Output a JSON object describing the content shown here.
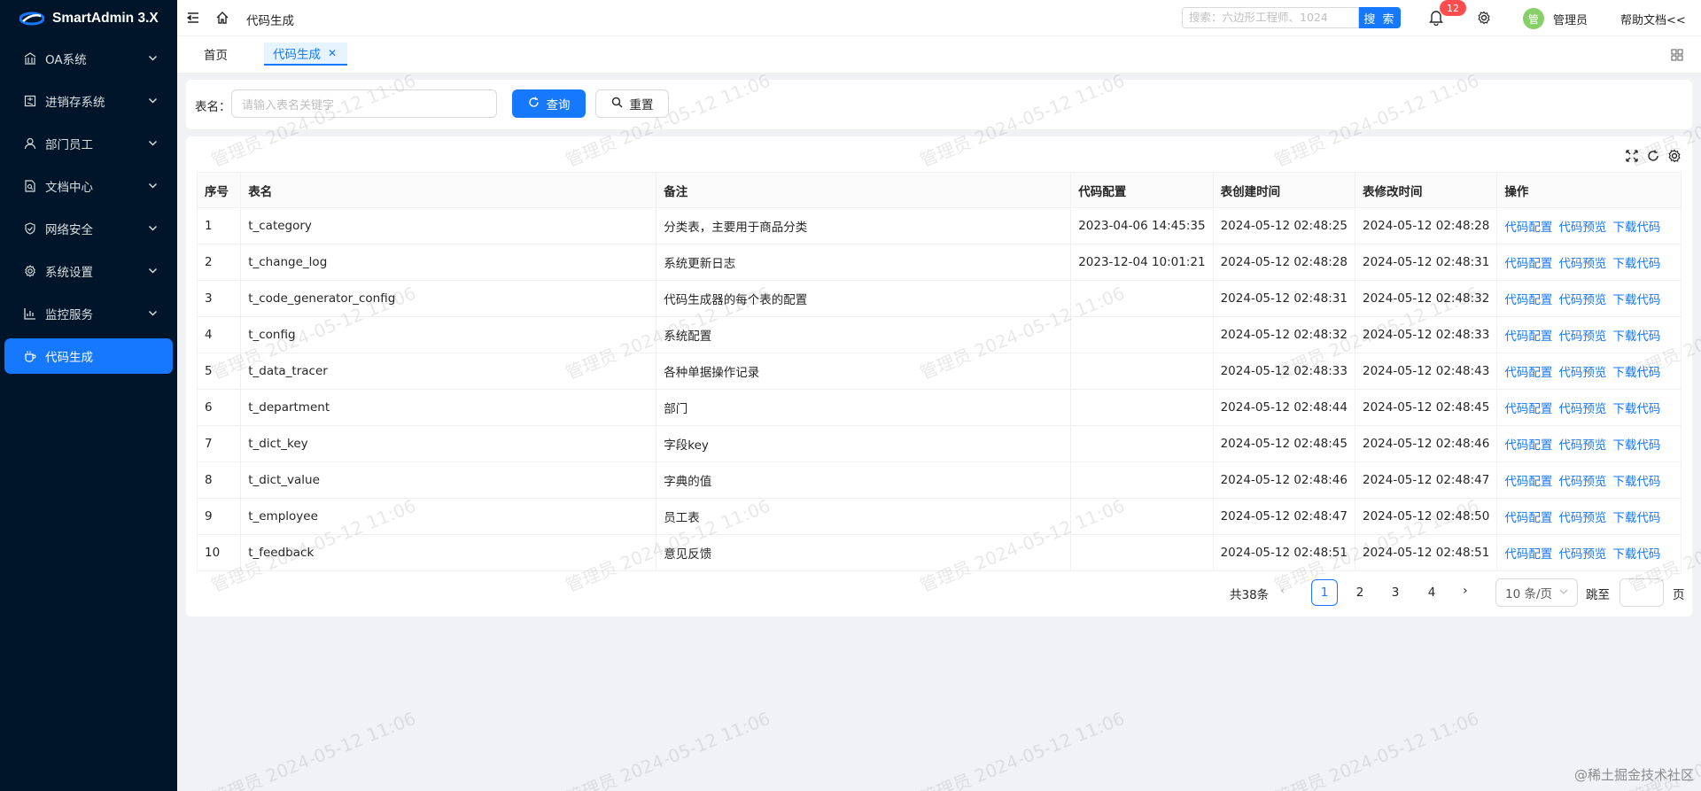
{
  "app": {
    "name": "SmartAdmin 3.X"
  },
  "sidebar": {
    "items": [
      {
        "label": "OA系统",
        "icon": "bank-icon",
        "has_children": true,
        "active": false
      },
      {
        "label": "进销存系统",
        "icon": "calculator-icon",
        "has_children": true,
        "active": false
      },
      {
        "label": "部门员工",
        "icon": "user-icon",
        "has_children": true,
        "active": false
      },
      {
        "label": "文档中心",
        "icon": "file-search-icon",
        "has_children": true,
        "active": false
      },
      {
        "label": "网络安全",
        "icon": "safety-icon",
        "has_children": true,
        "active": false
      },
      {
        "label": "系统设置",
        "icon": "setting-icon",
        "has_children": true,
        "active": false
      },
      {
        "label": "监控服务",
        "icon": "bar-chart-icon",
        "has_children": true,
        "active": false
      },
      {
        "label": "代码生成",
        "icon": "coffee-icon",
        "has_children": false,
        "active": true
      }
    ]
  },
  "header": {
    "breadcrumb": "代码生成",
    "search_placeholder": "搜索：六边形工程师、1024",
    "search_button": "搜 索",
    "notification_count": "12",
    "avatar_text": "管",
    "username": "管理员",
    "help_label": "帮助文档<<"
  },
  "tabs": [
    {
      "label": "首页",
      "active": false,
      "closable": false
    },
    {
      "label": "代码生成",
      "active": true,
      "closable": true
    }
  ],
  "filter": {
    "label": "表名：",
    "placeholder": "请输入表名关键字",
    "query_button": "查询",
    "reset_button": "重置"
  },
  "table": {
    "columns": [
      "序号",
      "表名",
      "备注",
      "代码配置",
      "表创建时间",
      "表修改时间",
      "操作"
    ],
    "rows": [
      [
        "1",
        "t_category",
        "分类表，主要用于商品分类",
        "2023-04-06 14:45:35",
        "2024-05-12 02:48:25",
        "2024-05-12 02:48:28"
      ],
      [
        "2",
        "t_change_log",
        "系统更新日志",
        "2023-12-04 10:01:21",
        "2024-05-12 02:48:28",
        "2024-05-12 02:48:31"
      ],
      [
        "3",
        "t_code_generator_config",
        "代码生成器的每个表的配置",
        "",
        "2024-05-12 02:48:31",
        "2024-05-12 02:48:32"
      ],
      [
        "4",
        "t_config",
        "系统配置",
        "",
        "2024-05-12 02:48:32",
        "2024-05-12 02:48:33"
      ],
      [
        "5",
        "t_data_tracer",
        "各种单据操作记录",
        "",
        "2024-05-12 02:48:33",
        "2024-05-12 02:48:43"
      ],
      [
        "6",
        "t_department",
        "部门",
        "",
        "2024-05-12 02:48:44",
        "2024-05-12 02:48:45"
      ],
      [
        "7",
        "t_dict_key",
        "字段key",
        "",
        "2024-05-12 02:48:45",
        "2024-05-12 02:48:46"
      ],
      [
        "8",
        "t_dict_value",
        "字典的值",
        "",
        "2024-05-12 02:48:46",
        "2024-05-12 02:48:47"
      ],
      [
        "9",
        "t_employee",
        "员工表",
        "",
        "2024-05-12 02:48:47",
        "2024-05-12 02:48:50"
      ],
      [
        "10",
        "t_feedback",
        "意见反馈",
        "",
        "2024-05-12 02:48:51",
        "2024-05-12 02:48:51"
      ]
    ],
    "actions": [
      "代码配置",
      "代码预览",
      "下载代码"
    ]
  },
  "pagination": {
    "total_text": "共38条",
    "pages": [
      "1",
      "2",
      "3",
      "4"
    ],
    "current": "1",
    "page_size": "10 条/页",
    "jump_label": "跳至",
    "page_label": "页"
  },
  "watermark": "管理员 2024-05-12 11:06",
  "corner_mark": "@稀土掘金技术社区",
  "colors": {
    "sidebar_bg": "#001529",
    "primary": "#1677ff",
    "badge": "#ff4d4f",
    "avatar": "#87d068"
  }
}
